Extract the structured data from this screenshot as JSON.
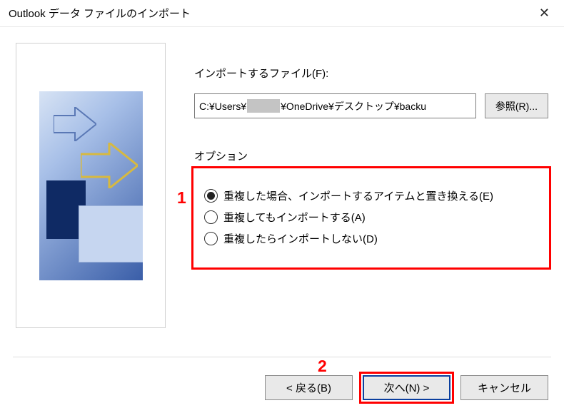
{
  "window": {
    "title": "Outlook データ ファイルのインポート"
  },
  "file": {
    "label": "インポートするファイル(F):",
    "path_prefix": "C:¥Users¥",
    "path_suffix": "¥OneDrive¥デスクトップ¥backu",
    "browse": "参照(R)..."
  },
  "options": {
    "group_label": "オプション",
    "items": [
      {
        "label": "重複した場合、インポートするアイテムと置き換える(E)",
        "checked": true
      },
      {
        "label": "重複してもインポートする(A)",
        "checked": false
      },
      {
        "label": "重複したらインポートしない(D)",
        "checked": false
      }
    ]
  },
  "footer": {
    "back": "< 戻る(B)",
    "next": "次へ(N) >",
    "cancel": "キャンセル"
  },
  "annotations": {
    "one": "1",
    "two": "2"
  }
}
